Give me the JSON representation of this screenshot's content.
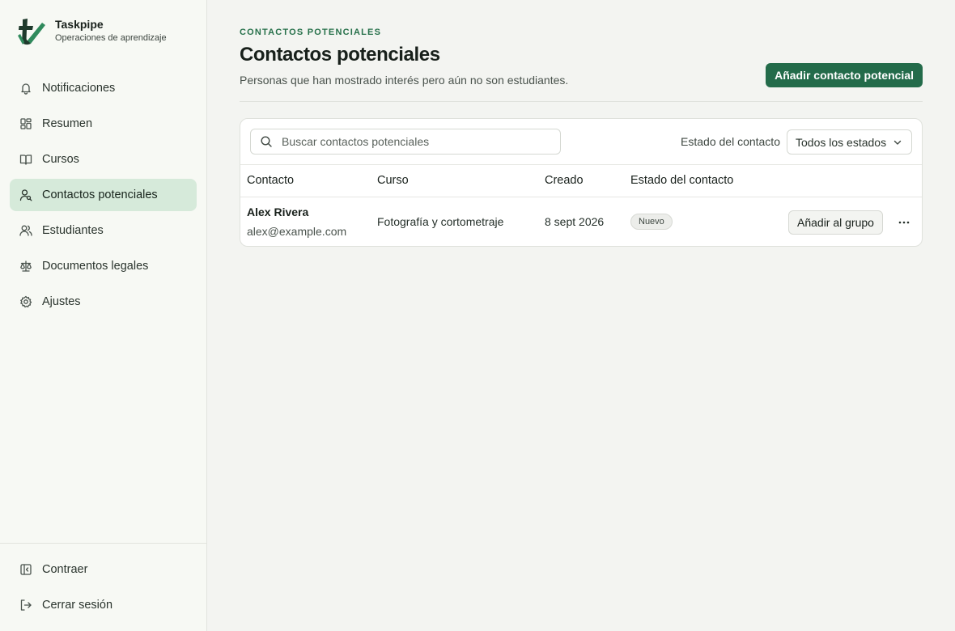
{
  "brand": {
    "name": "Taskpipe",
    "subtitle": "Operaciones de aprendizaje"
  },
  "sidebar": {
    "items": [
      {
        "label": "Notificaciones",
        "icon": "bell-icon"
      },
      {
        "label": "Resumen",
        "icon": "dashboard-icon"
      },
      {
        "label": "Cursos",
        "icon": "book-icon"
      },
      {
        "label": "Contactos potenciales",
        "icon": "user-search-icon",
        "active": true
      },
      {
        "label": "Estudiantes",
        "icon": "users-icon"
      },
      {
        "label": "Documentos legales",
        "icon": "scale-icon"
      },
      {
        "label": "Ajustes",
        "icon": "gear-icon"
      }
    ],
    "footer": [
      {
        "label": "Contraer",
        "icon": "collapse-sidebar-icon"
      },
      {
        "label": "Cerrar sesión",
        "icon": "logout-icon"
      }
    ]
  },
  "header": {
    "eyebrow": "CONTACTOS POTENCIALES",
    "title": "Contactos potenciales",
    "description": "Personas que han mostrado interés pero aún no son estudiantes.",
    "add_button": "Añadir contacto potencial"
  },
  "toolbar": {
    "search_placeholder": "Buscar contactos potenciales",
    "filter_label": "Estado del contacto",
    "filter_value": "Todos los estados"
  },
  "table": {
    "columns": [
      "Contacto",
      "Curso",
      "Creado",
      "Estado del contacto"
    ],
    "rows": [
      {
        "name": "Alex Rivera",
        "email": "alex@example.com",
        "course": "Fotografía y cortometraje",
        "created": "8 sept 2026",
        "status": "Nuevo",
        "action": "Añadir al grupo"
      }
    ]
  },
  "colors": {
    "accent": "#236b4a",
    "active_nav": "#d6eada",
    "eyebrow": "#26704a"
  }
}
